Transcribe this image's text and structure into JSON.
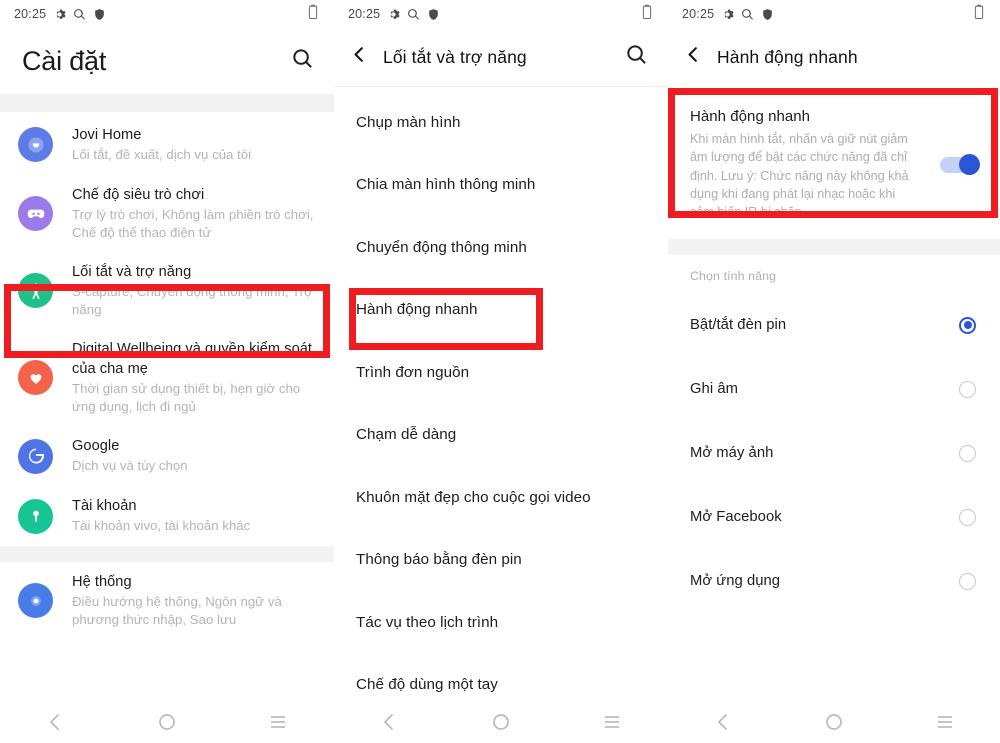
{
  "statusbar": {
    "time": "20:25",
    "icons": [
      "gear-icon",
      "search-icon",
      "shield-icon"
    ],
    "battery": "battery-icon"
  },
  "panel1": {
    "header": {
      "title": "Cài đặt",
      "search_icon": "search-icon"
    },
    "items": [
      {
        "title": "Jovi Home",
        "subtitle": "Lối tắt, đề xuất, dịch vụ của tôi",
        "icon": "jovi-icon",
        "icon_color": "#5d7ce8",
        "highlighted": false
      },
      {
        "title": "Chế độ siêu trò chơi",
        "subtitle": "Trợ lý trò chơi, Không làm phiền trò chơi, Chế độ thể thao điện tử",
        "icon": "gamepad-icon",
        "icon_color": "#9b7bea",
        "highlighted": false
      },
      {
        "title": "Lối tắt và trợ năng",
        "subtitle": "S-capture, Chuyển động thông minh, Trợ năng",
        "icon": "accessibility-icon",
        "icon_color": "#1fc08a",
        "highlighted": true
      },
      {
        "title": "Digital Wellbeing và quyền kiểm soát của cha mẹ",
        "subtitle": "Thời gian sử dụng thiết bị, hẹn giờ cho ứng dụng, lịch đi ngủ",
        "icon": "heart-icon",
        "icon_color": "#f4624a",
        "highlighted": false
      },
      {
        "title": "Google",
        "subtitle": "Dịch vụ và tùy chọn",
        "icon": "google-g-icon",
        "icon_color": "#4f74e3",
        "highlighted": false
      },
      {
        "title": "Tài khoản",
        "subtitle": "Tài khoản vivo, tài khoản khác",
        "icon": "key-icon",
        "icon_color": "#17c496",
        "highlighted": false
      }
    ],
    "system_item": {
      "title": "Hệ thống",
      "subtitle": "Điều hướng hệ thống, Ngôn ngữ và phương thức nhập, Sao lưu",
      "icon": "system-icon",
      "icon_color": "#4a7ce8"
    }
  },
  "panel2": {
    "header": {
      "back_icon": "back-chevron-icon",
      "title": "Lối tắt và trợ năng",
      "search_icon": "search-icon"
    },
    "items": [
      {
        "label": "Chụp màn hình",
        "highlighted": false
      },
      {
        "label": "Chia màn hình thông minh",
        "highlighted": false
      },
      {
        "label": "Chuyển động thông minh",
        "highlighted": false
      },
      {
        "label": "Hành động nhanh",
        "highlighted": true
      },
      {
        "label": "Trình đơn nguồn",
        "highlighted": false
      },
      {
        "label": "Chạm dễ dàng",
        "highlighted": false
      },
      {
        "label": "Khuôn mặt đẹp cho cuộc gọi video",
        "highlighted": false
      },
      {
        "label": "Thông báo bằng đèn pin",
        "highlighted": false
      },
      {
        "label": "Tác vụ theo lịch trình",
        "highlighted": false
      },
      {
        "label": "Chế độ dùng một tay",
        "highlighted": false
      }
    ]
  },
  "panel3": {
    "header": {
      "back_icon": "back-chevron-icon",
      "title": "Hành động nhanh"
    },
    "card": {
      "title": "Hành động nhanh",
      "description": "Khi màn hình tắt, nhấn và giữ nút giảm âm lượng để bật các chức năng đã chỉ định. Lưu ý: Chức năng này không khả dụng khi đang phát lại nhạc hoặc khi cảm biến IR bị chặn.",
      "toggle_on": true,
      "highlighted": true
    },
    "section_label": "Chọn tính năng",
    "options": [
      {
        "label": "Bật/tắt đèn pin",
        "selected": true
      },
      {
        "label": "Ghi âm",
        "selected": false
      },
      {
        "label": "Mở máy ảnh",
        "selected": false
      },
      {
        "label": "Mở Facebook",
        "selected": false
      },
      {
        "label": "Mở ứng dụng",
        "selected": false
      }
    ]
  },
  "navbar": {
    "back": "back-chevron-icon",
    "home": "home-circle-icon",
    "recents": "recents-menu-icon"
  },
  "colors": {
    "annotation": "#ef1c22",
    "accent": "#2b55d4"
  }
}
